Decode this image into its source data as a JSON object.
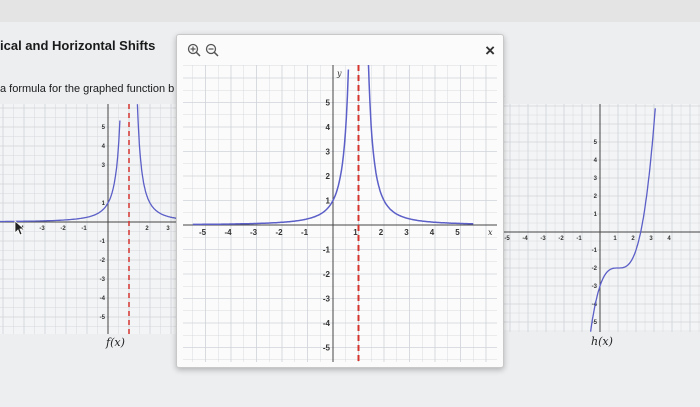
{
  "page": {
    "heading": "ical and Horizontal Shifts",
    "instruction": "a formula for the graphed function b",
    "trailing_dot": "."
  },
  "modal": {
    "zoom_in_icon": "zoom-in",
    "zoom_out_icon": "zoom-out",
    "close_label": "×"
  },
  "colors": {
    "curve": "#5b5fc7",
    "asymptote": "#d4352f",
    "grid": "#cfd3d8",
    "axis": "#444444"
  },
  "chart_data": [
    {
      "type": "line",
      "name": "modal-graph",
      "title": "",
      "xlabel": "x",
      "ylabel": "y",
      "xlim": [
        -5.6,
        5.6
      ],
      "ylim": [
        -5.6,
        6.5
      ],
      "xticks": [
        "-5",
        "-4",
        "-3",
        "-2",
        "-1",
        "1",
        "2",
        "3",
        "4",
        "5"
      ],
      "yticks": [
        "-5",
        "-4",
        "-3",
        "-2",
        "-1",
        "1",
        "2",
        "3",
        "4",
        "5"
      ],
      "vertical_asymptote_x": 1,
      "horizontal_asymptote_y": 0,
      "series": [
        {
          "x": [
            -5.5,
            -4,
            -3,
            -2,
            -1,
            0,
            0.5,
            0.7,
            0.8
          ],
          "y": [
            0.03,
            0.04,
            0.06,
            0.11,
            0.25,
            1,
            4,
            11.1,
            25
          ]
        },
        {
          "x": [
            1.2,
            1.3,
            1.5,
            2,
            3,
            4,
            5,
            5.5
          ],
          "y": [
            25,
            11.1,
            4,
            1,
            0.25,
            0.11,
            0.06,
            0.05
          ]
        }
      ]
    },
    {
      "type": "line",
      "name": "f(x)",
      "title": "",
      "fn_label": "f(x)",
      "xticks": [
        "-4",
        "-3",
        "-2",
        "-1",
        "2",
        "3"
      ],
      "yticks": [
        "-5",
        "-4",
        "-3",
        "-2",
        "-1",
        "1",
        "3",
        "4",
        "5"
      ],
      "vertical_asymptote_x": 1
    },
    {
      "type": "line",
      "name": "h(x)",
      "title": "",
      "fn_label": "h(x)",
      "xticks": [
        "-5",
        "-4",
        "-3",
        "-2",
        "-1",
        "1",
        "2",
        "3",
        "4"
      ],
      "yticks": [
        "-5",
        "-4",
        "-3",
        "-2",
        "-1",
        "1",
        "2",
        "3",
        "4",
        "5"
      ]
    }
  ]
}
